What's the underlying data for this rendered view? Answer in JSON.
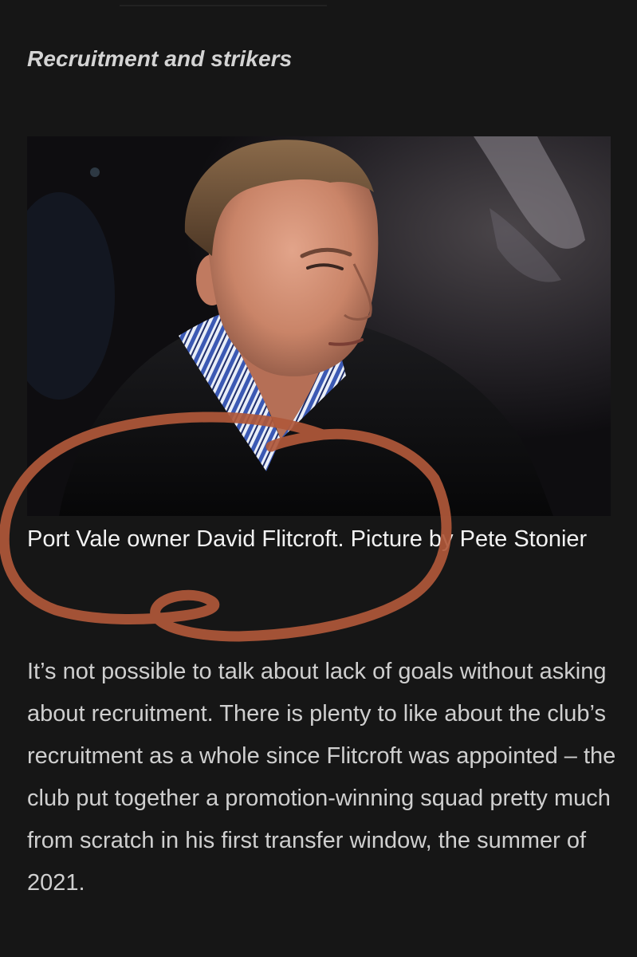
{
  "article": {
    "section_heading": "Recruitment and strikers",
    "image": {
      "subject": "portrait",
      "shirt_stripe_color": "#3b59b4"
    },
    "caption": "Port Vale owner David Flitcroft. Picture by Pete Stonier",
    "paragraph": "It’s not possible to talk about lack of goals without asking about recruitment. There is plenty to like about the club’s recruitment as a whole since Flitcroft was appointed – the club put together a promotion-winning squad pretty much from scratch in his first transfer window, the summer of 2021."
  },
  "annotation": {
    "shape": "hand-drawn-circle",
    "color": "#b0583a"
  }
}
